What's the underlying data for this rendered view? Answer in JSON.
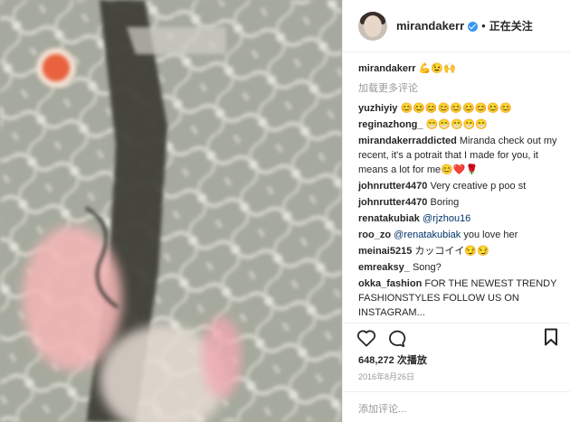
{
  "header": {
    "username": "mirandakerr",
    "separator": "•",
    "follow_label": "正在关注"
  },
  "caption": {
    "username": "mirandakerr",
    "emojis": "💪😉🙌"
  },
  "load_more_label": "加载更多评论",
  "comments": [
    {
      "user": "yuzhiyiy",
      "text": "😊😊😊😊😊😊😊😊😊"
    },
    {
      "user": "reginazhong_",
      "text": "😁😁😁😁😁"
    },
    {
      "user": "mirandakerraddicted",
      "text": "Miranda check out my recent, it's a potrait that I made for you, it means a lot for me😊❤️🌹"
    },
    {
      "user": "johnrutter4470",
      "text": "Very creative p poo st"
    },
    {
      "user": "johnrutter4470",
      "text": "Boring"
    },
    {
      "user": "renatakubiak",
      "mention": "@rjzhou16",
      "text": ""
    },
    {
      "user": "roo_zo",
      "mention": "@renatakubiak",
      "text": " you love her"
    },
    {
      "user": "meinai5215",
      "text": "カッコイイ😏😏"
    },
    {
      "user": "emreaksy_",
      "text": "Song?"
    },
    {
      "user": "okka_fashion",
      "text": "FOR THE NEWEST TRENDY FASHIONSTYLES FOLLOW US ON INSTAGRAM..."
    }
  ],
  "likes": {
    "count": "648,272",
    "label": "次播放"
  },
  "date": "2016年8月26日",
  "add_comment_placeholder": "添加评论...",
  "icons": {
    "like": "heart-icon",
    "comment": "comment-bubble-icon",
    "save": "bookmark-icon"
  },
  "colors": {
    "text": "#262626",
    "muted": "#999999",
    "verified": "#3897f0",
    "mention": "#003569",
    "border": "#efefef"
  }
}
